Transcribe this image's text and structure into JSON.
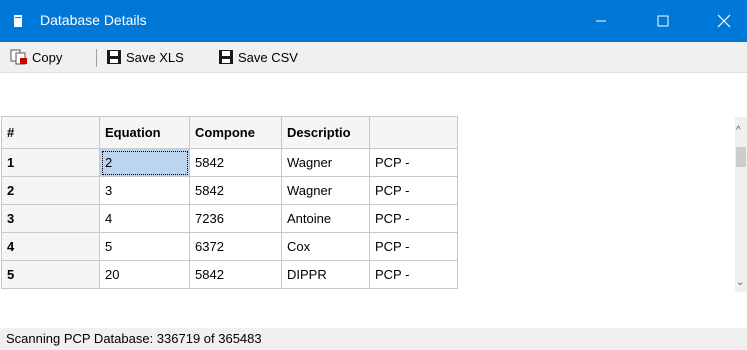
{
  "window": {
    "title": "Database Details",
    "app_icon": "database-icon",
    "controls": [
      "minimize-icon",
      "maximize-icon",
      "close-icon"
    ],
    "accent_color": "#0078d7"
  },
  "toolbar": {
    "copy_label": "Copy",
    "copy_icon": "copy-icon",
    "save_xls_label": "Save XLS",
    "save_xls_icon": "floppy-disk-icon",
    "save_csv_label": "Save CSV",
    "save_csv_icon": "floppy-disk-icon"
  },
  "grid": {
    "columns": [
      "#",
      "Equation",
      "Compone",
      "Descriptio",
      ""
    ],
    "rows": [
      [
        "1",
        "2",
        "5842",
        "Wagner",
        "PCP -"
      ],
      [
        "2",
        "3",
        "5842",
        "Wagner",
        "PCP -"
      ],
      [
        "3",
        "4",
        "7236",
        "Antoine",
        "PCP -"
      ],
      [
        "4",
        "5",
        "6372",
        "Cox",
        "PCP -"
      ],
      [
        "5",
        "20",
        "5842",
        "DIPPR",
        "PCP -"
      ]
    ],
    "selected_cell": "row 1, Equation"
  },
  "status": {
    "text": "Scanning PCP Database: 336719 of 365483"
  }
}
